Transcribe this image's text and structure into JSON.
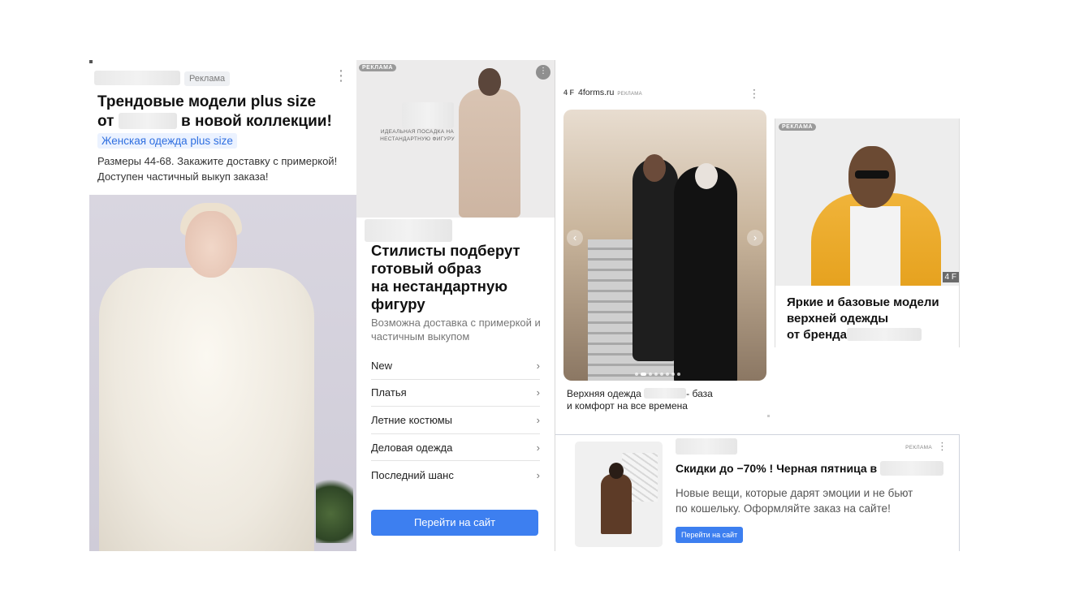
{
  "ad1": {
    "badge": "Реклама",
    "title_line1": "Трендовые модели plus size",
    "title_prefix": "от",
    "title_suffix": "в новой коллекции!",
    "link": "Женская одежда plus size",
    "desc_line1": "Размеры 44-68. Закажите доставку с примеркой!",
    "desc_line2": "Доступен частичный выкуп заказа!"
  },
  "ad2": {
    "badge": "РЕКЛАМА",
    "hero_caption": "ИДЕАЛЬНАЯ ПОСАДКА НА НЕСТАНДАРТНУЮ ФИГУРУ",
    "title_line1": "Стилисты подберут",
    "title_line2": "готовый образ",
    "title_line3": "на нестандартную",
    "title_line4": "фигуру",
    "desc": "Возможна доставка с примеркой и частичным выкупом",
    "links": [
      "New",
      "Платья",
      "Летние костюмы",
      "Деловая одежда",
      "Последний шанс"
    ],
    "cta": "Перейти на сайт"
  },
  "ad3": {
    "brand_logo": "4 F",
    "domain": "4forms.ru",
    "badge": "РЕКЛАМА",
    "caption_prefix": "Верхняя одежда",
    "caption_suffix": "- база",
    "caption_line2": "и комфорт на все времена"
  },
  "ad4": {
    "badge": "РЕКЛАМА",
    "brand_mark": "4 F",
    "title_line1": "Яркие и базовые модели",
    "title_line2": "верхней одежды",
    "title_prefix3": "от бренда"
  },
  "ad5": {
    "badge": "РЕКЛАМА",
    "title": "Скидки до −70% ! Черная пятница в",
    "desc_line1": "Новые вещи, которые дарят эмоции и не бьют",
    "desc_line2": "по кошельку. Оформляйте заказ на сайте!",
    "cta": "Перейти на сайт"
  },
  "icons": {
    "menu": "⋮",
    "chevron": "›",
    "arrow_left": "‹",
    "arrow_right": "›"
  },
  "colors": {
    "accent_blue": "#3d7ff0",
    "link_blue": "#2f6fe0",
    "jacket_yellow": "#f0b43a"
  }
}
